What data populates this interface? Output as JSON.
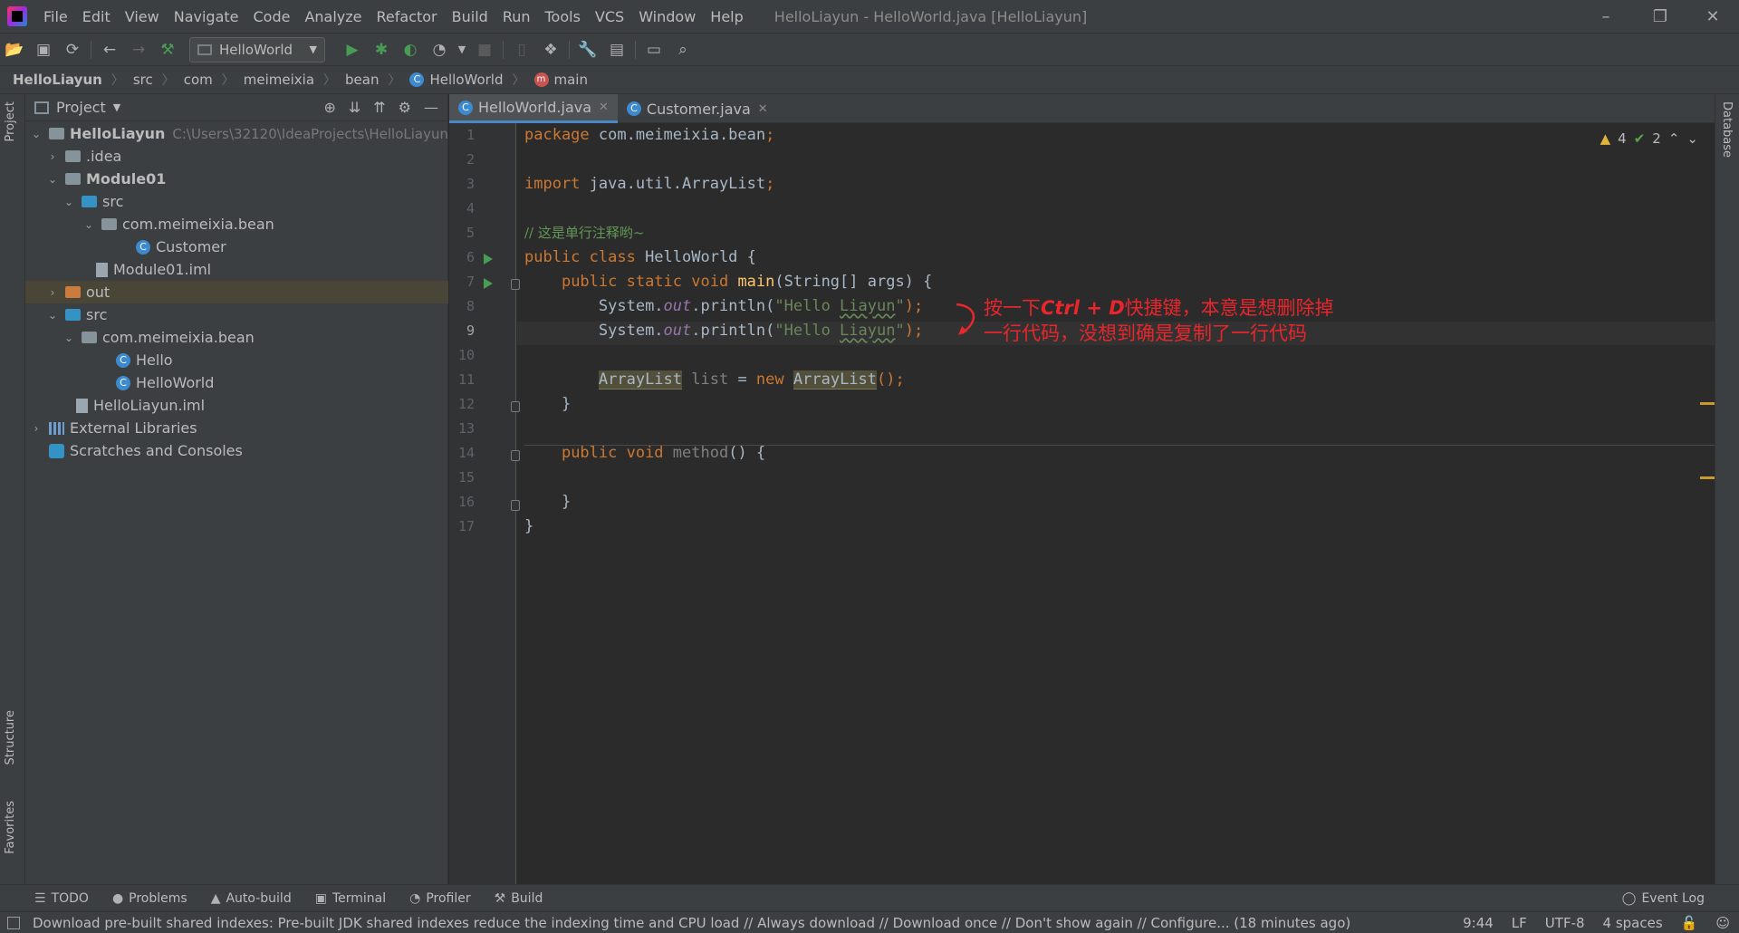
{
  "window": {
    "title": "HelloLiayun - HelloWorld.java [HelloLiayun]",
    "minimize": "–",
    "restore": "❐",
    "close": "✕"
  },
  "menu": [
    "File",
    "Edit",
    "View",
    "Navigate",
    "Code",
    "Analyze",
    "Refactor",
    "Build",
    "Run",
    "Tools",
    "VCS",
    "Window",
    "Help"
  ],
  "toolbar": {
    "run_config": "HelloWorld"
  },
  "breadcrumb": {
    "items": [
      "HelloLiayun",
      "src",
      "com",
      "meimeixia",
      "bean",
      "HelloWorld",
      "main"
    ]
  },
  "sidebar": {
    "left_tabs": [
      "Project",
      "Structure",
      "Favorites"
    ],
    "right_tabs": [
      "Database"
    ]
  },
  "project_panel": {
    "title": "Project",
    "tree": [
      {
        "label": "HelloLiayun",
        "hint": "C:\\Users\\32120\\IdeaProjects\\HelloLiayun"
      },
      {
        "label": ".idea"
      },
      {
        "label": "Module01"
      },
      {
        "label": "src"
      },
      {
        "label": "com.meimeixia.bean"
      },
      {
        "label": "Customer"
      },
      {
        "label": "Module01.iml"
      },
      {
        "label": "out"
      },
      {
        "label": "src"
      },
      {
        "label": "com.meimeixia.bean"
      },
      {
        "label": "Hello"
      },
      {
        "label": "HelloWorld"
      },
      {
        "label": "HelloLiayun.iml"
      },
      {
        "label": "External Libraries"
      },
      {
        "label": "Scratches and Consoles"
      }
    ]
  },
  "tabs": [
    {
      "label": "HelloWorld.java",
      "active": true
    },
    {
      "label": "Customer.java",
      "active": false
    }
  ],
  "editor": {
    "line_numbers": [
      "1",
      "2",
      "3",
      "4",
      "5",
      "6",
      "7",
      "8",
      "9",
      "10",
      "11",
      "12",
      "13",
      "14",
      "15",
      "16",
      "17"
    ],
    "current_line": "9",
    "code": {
      "l1_kw": "package",
      "l1_rest": " com.meimeixia.bean",
      "l1_semi": ";",
      "l3_kw": "import",
      "l3_rest": " java.util.ArrayList",
      "l3_semi": ";",
      "l5_comment": "// 这是单行注释哟~",
      "l6_kw": "public class",
      "l6_rest": " HelloWorld {",
      "l7_kw": "public static void",
      "l7_fn": "main",
      "l7_rest": "(String[] args) {",
      "l8_pre": "System.",
      "l8_out": "out",
      "l8_call": ".println(",
      "l8_str1": "\"Hello ",
      "l8_typo": "Liayun",
      "l8_str2": "\"",
      "l8_end": ");",
      "l9_pre": "System.",
      "l9_out": "out",
      "l9_call": ".println(",
      "l9_str1": "\"Hello ",
      "l9_typo": "Liayun",
      "l9_str2": "\"",
      "l9_end": ");",
      "l11_type": "ArrayList",
      "l11_var": " list",
      "l11_eq": " = ",
      "l11_new": "new",
      "l11_type2": "ArrayList",
      "l11_end": "();",
      "l12": "}",
      "l14_kw": "public void",
      "l14_fn": "method",
      "l14_rest": "() {",
      "l16": "}",
      "l17": "}"
    },
    "inspection": {
      "warnings": "4",
      "ok": "2"
    },
    "annotation": {
      "line1_pre": "按一下",
      "line1_key": "Ctrl + D",
      "line1_post": "快捷键，本意是想删除掉",
      "line2": "一行代码，没想到确是复制了一行代码"
    }
  },
  "bottom_tools": [
    "TODO",
    "Problems",
    "Auto-build",
    "Terminal",
    "Profiler",
    "Build"
  ],
  "event_log": "Event Log",
  "status": {
    "message": "Download pre-built shared indexes: Pre-built JDK shared indexes reduce the indexing time and CPU load // Always download // Download once // Don't show again // Configure... (18 minutes ago)",
    "position": "9:44",
    "line_sep": "LF",
    "encoding": "UTF-8",
    "indent": "4 spaces"
  },
  "colors": {
    "accent": "#4a88c7",
    "annotation": "#e8262b",
    "keyword": "#cc7832",
    "string": "#6a8759"
  }
}
